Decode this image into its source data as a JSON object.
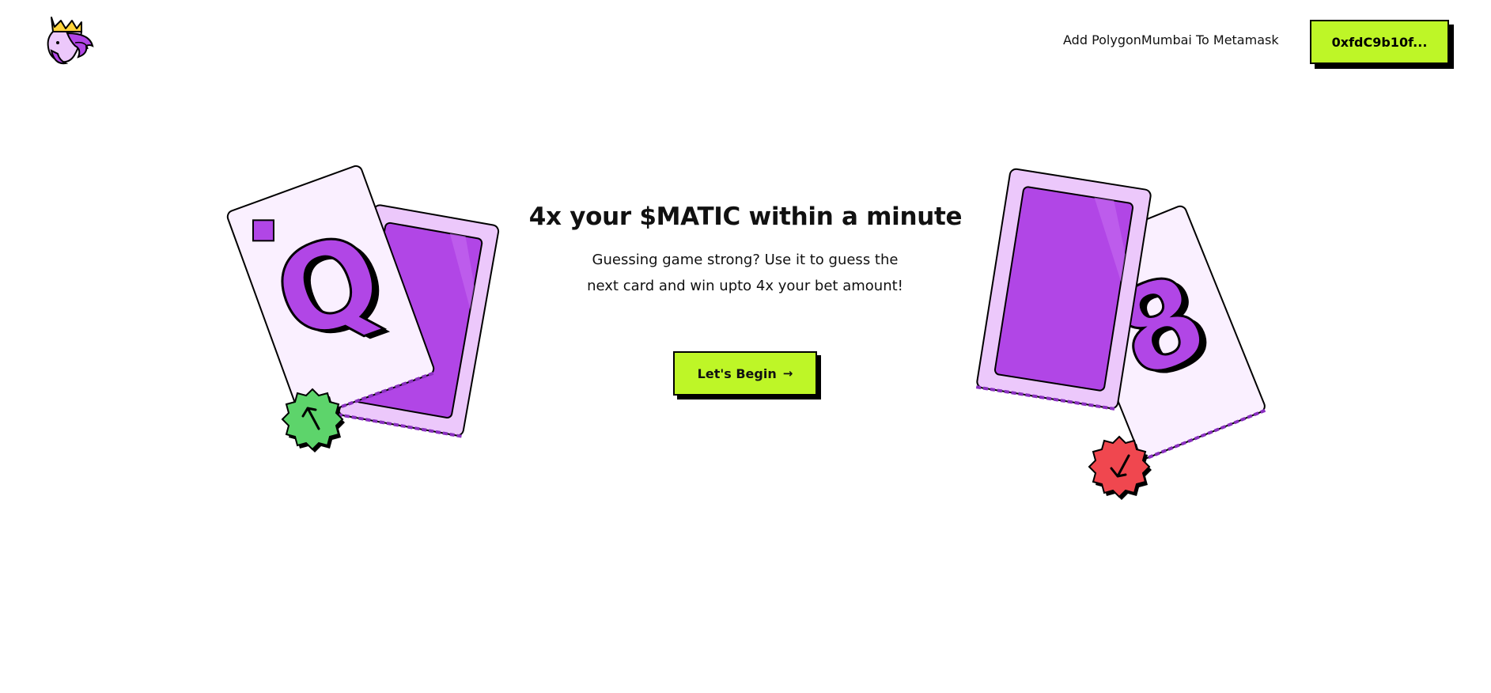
{
  "header": {
    "logo_icon": "king-logo-icon",
    "add_network_label": "Add PolygonMumbai To Metamask",
    "wallet_button_label": "0xfdC9b10f..."
  },
  "hero": {
    "title": "4x your $MATIC within a minute",
    "subtitle": "Guessing game strong? Use it to guess the next card and win upto 4x your bet amount!",
    "cta_label": "Let's Begin",
    "cta_icon": "arrow-right-icon"
  },
  "illustrations": {
    "left_card_rank": "Q",
    "right_card_rank": "8",
    "left_chip_icon": "arrow-up-icon",
    "right_chip_icon": "arrow-down-icon"
  },
  "colors": {
    "accent": "#bef627",
    "purple": "#b146e6",
    "light_purple": "#ecc8fb",
    "card_bg": "#faf0ff",
    "green_chip": "#5dd46b",
    "red_chip": "#f0474f"
  }
}
